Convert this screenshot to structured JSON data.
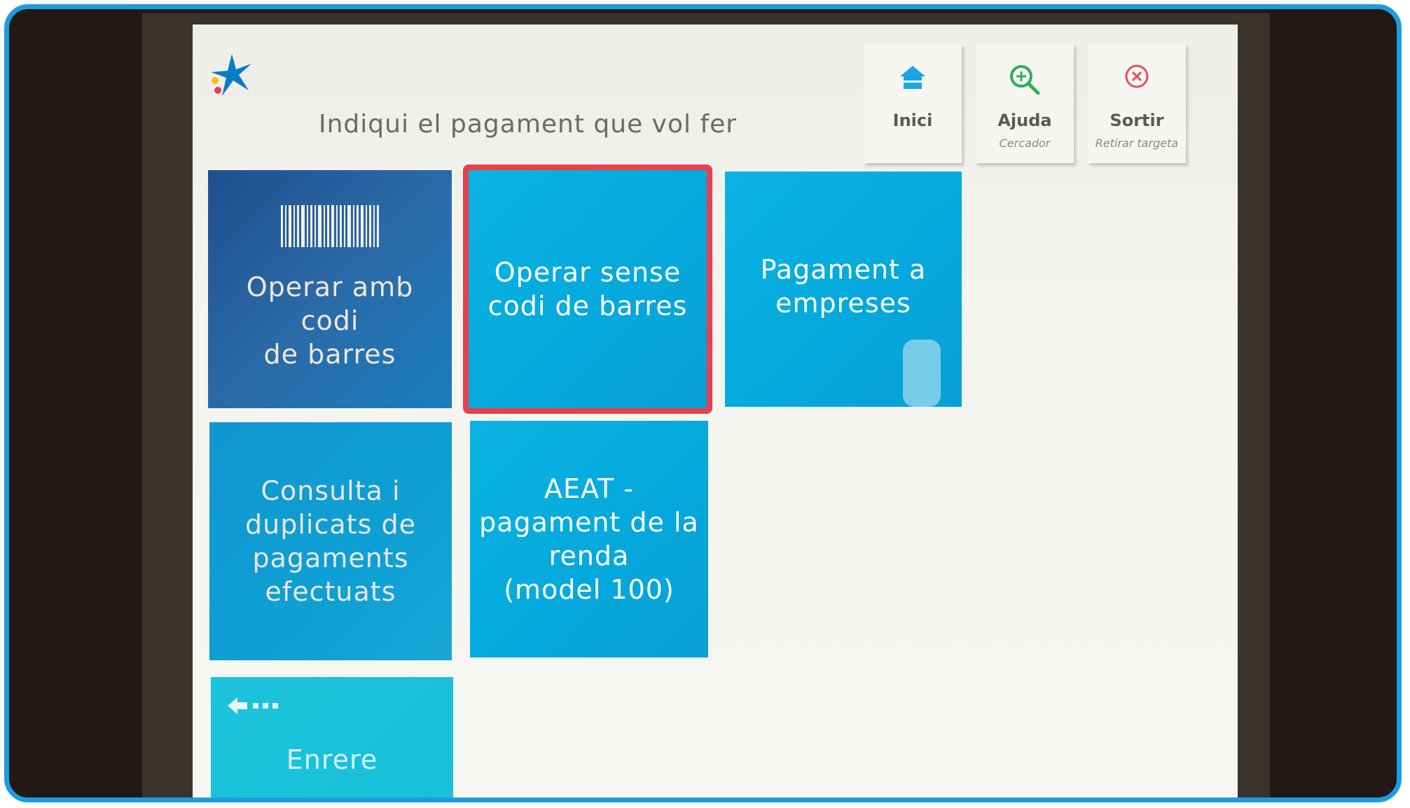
{
  "header": {
    "title": "Indiqui el pagament que vol fer"
  },
  "top_buttons": [
    {
      "label": "Inici",
      "sublabel": "",
      "icon": "home-icon",
      "color": "#1aa6e0"
    },
    {
      "label": "Ajuda",
      "sublabel": "Cercador",
      "icon": "magnifier-plus-icon",
      "color": "#2bb05a"
    },
    {
      "label": "Sortir",
      "sublabel": "Retirar targeta",
      "icon": "close-circle-icon",
      "color": "#e8505a"
    }
  ],
  "tiles": {
    "barcode": {
      "line1": "Operar amb codi",
      "line2": "de barres",
      "icon": "barcode-icon"
    },
    "no_barcode": {
      "line1": "Operar sense",
      "line2": "codi de barres"
    },
    "companies": {
      "line1": "Pagament a",
      "line2": "empreses"
    },
    "consulta": {
      "line1": "Consulta i",
      "line2": "duplicats de",
      "line3": "pagaments",
      "line4": "efectuats"
    },
    "aeat": {
      "line1": "AEAT -",
      "line2": "pagament de la",
      "line3": "renda",
      "line4": "(model 100)"
    },
    "back": {
      "label": "Enrere",
      "icon": "arrow-left-icon"
    }
  },
  "colors": {
    "tile_blue": "#05a8dc",
    "highlight": "#e8404c",
    "frame": "#1a9ee0"
  }
}
